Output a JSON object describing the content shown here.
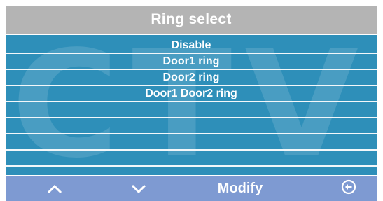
{
  "title": "Ring select",
  "watermark": "CTV",
  "options": [
    "Disable",
    "Door1 ring",
    "Door2 ring",
    "Door1 Door2 ring",
    "",
    "",
    "",
    "",
    ""
  ],
  "toolbar": {
    "up_icon": "chevron-up-icon",
    "down_icon": "chevron-down-icon",
    "modify_label": "Modify",
    "back_icon": "back-arrow-circle-icon"
  },
  "colors": {
    "title_bar": "#b4b4b4",
    "list_background": "#2e8fb9",
    "bottom_bar": "#7e9ad2",
    "text": "#ffffff"
  }
}
